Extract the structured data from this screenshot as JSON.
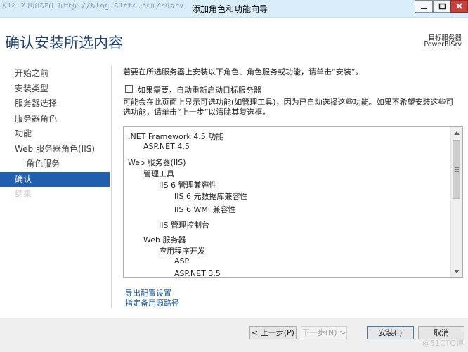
{
  "window": {
    "watermark": "018 ZJUNSEN http://blog.51cto.com/rdsrv",
    "title": "添加角色和功能向导"
  },
  "header": {
    "page_title": "确认安装所选内容",
    "target_label": "目标服务器",
    "target_value": "PowerBISrv"
  },
  "nav": {
    "items": [
      {
        "label": "开始之前",
        "state": "normal"
      },
      {
        "label": "安装类型",
        "state": "normal"
      },
      {
        "label": "服务器选择",
        "state": "normal"
      },
      {
        "label": "服务器角色",
        "state": "normal"
      },
      {
        "label": "功能",
        "state": "normal"
      },
      {
        "label": "Web 服务器角色(IIS)",
        "state": "normal"
      },
      {
        "label": "角色服务",
        "state": "sub"
      },
      {
        "label": "确认",
        "state": "active"
      },
      {
        "label": "结果",
        "state": "disabled"
      }
    ]
  },
  "content": {
    "intro": "若要在所选服务器上安装以下角色、角色服务或功能，请单击“安装”。",
    "restart_label": "如果需要，自动重新启动目标服务器",
    "restart_checked": false,
    "note": "可能会在此页面上显示可选功能(如管理工具)，因为已自动选择这些功能。如果不希望安装这些可选功能，请单击“上一步”以清除其复选框。"
  },
  "selection_list": [
    {
      "text": ".NET Framework 4.5 功能"
    },
    {
      "text": "ASP.NET 4.5"
    },
    {
      "text": "Web 服务器(IIS)"
    },
    {
      "text": "管理工具"
    },
    {
      "text": "IIS 6 管理兼容性"
    },
    {
      "text": "IIS 6 元数据库兼容性"
    },
    {
      "text": "IIS 6 WMI 兼容性"
    },
    {
      "text": "IIS 管理控制台"
    },
    {
      "text": "Web 服务器"
    },
    {
      "text": "应用程序开发"
    },
    {
      "text": "ASP"
    },
    {
      "text": "ASP.NET 3.5"
    }
  ],
  "links": {
    "export": "导出配置设置",
    "alt_source": "指定备用源路径"
  },
  "footer": {
    "prev": "< 上一步(P)",
    "next": "下一步(N) >",
    "install": "安装(I)",
    "cancel": "取消",
    "watermark": "@51CTO博"
  },
  "colors": {
    "titlebar": "#d9eefa",
    "accent": "#1f5fae",
    "page_title": "#1b3f73",
    "link": "#1b5aa6",
    "close_button": "#c7413a"
  },
  "icons": [
    "minimize-icon",
    "maximize-icon",
    "close-icon",
    "scroll-up-icon",
    "scroll-down-icon",
    "scroll-grip-icon"
  ]
}
